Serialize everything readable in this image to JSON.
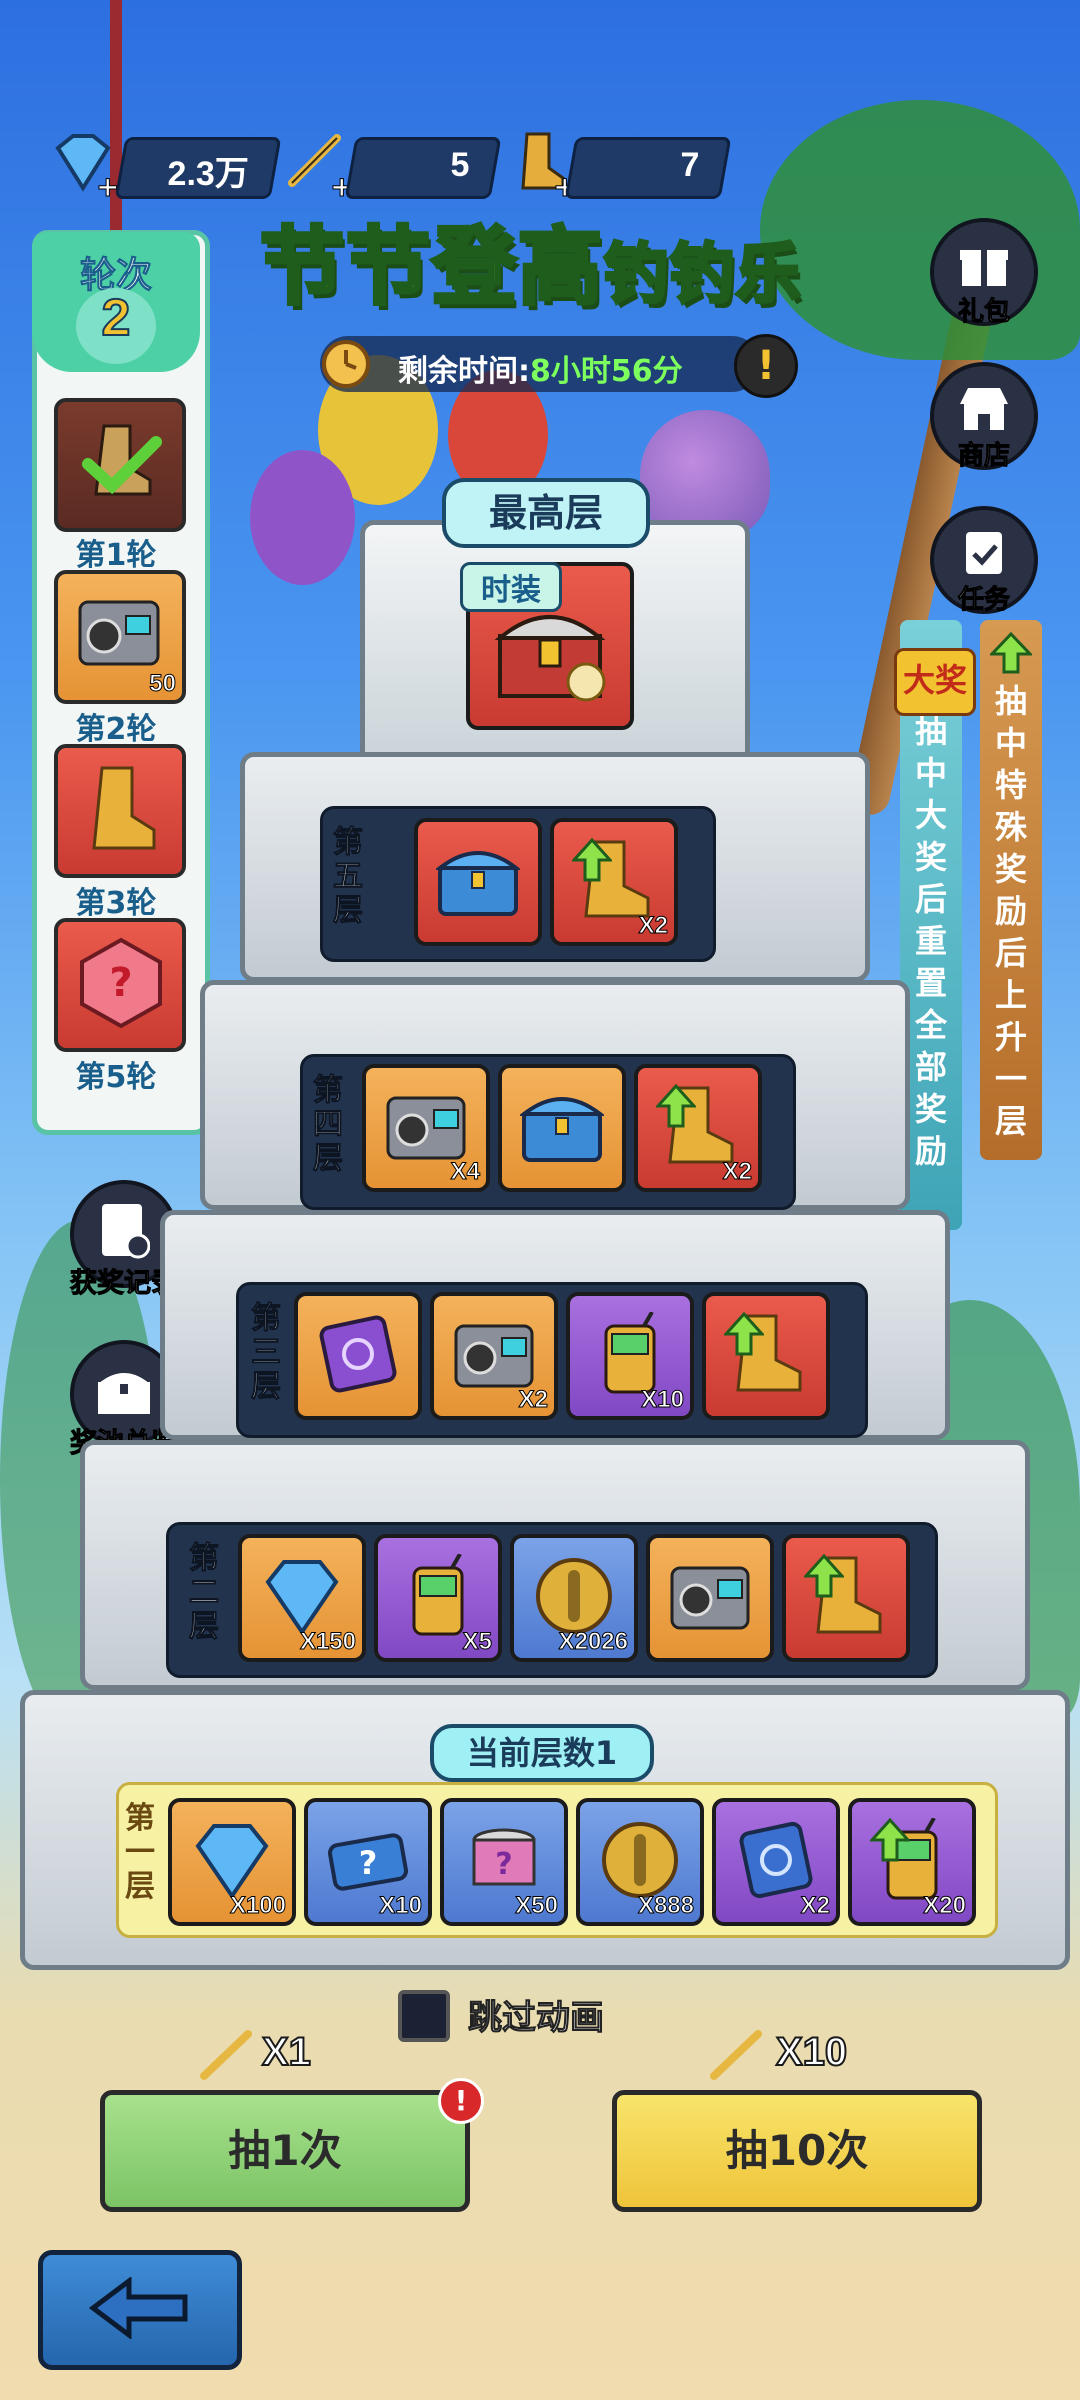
{
  "currency": {
    "diamonds": "2.3万",
    "rods": "5",
    "boots": "7"
  },
  "title": {
    "main": "节节登高",
    "sub": "钓钓乐"
  },
  "timer": {
    "label": "剩余时间:",
    "value": "8小时56分"
  },
  "side_buttons": [
    {
      "label": "礼包",
      "icon": "gift-icon"
    },
    {
      "label": "商店",
      "icon": "shop-icon"
    },
    {
      "label": "任务",
      "icon": "task-icon"
    }
  ],
  "banners": {
    "grand_tag": "大奖",
    "grand_text": "抽中大奖后重置全部奖励",
    "special_text": "抽中特殊奖励后上升一层"
  },
  "rounds": {
    "head_label": "轮次",
    "current": "2",
    "items": [
      {
        "label": "第1轮",
        "icon": "boot-checked-icon",
        "count": ""
      },
      {
        "label": "第2轮",
        "icon": "device-icon",
        "count": "50"
      },
      {
        "label": "第3轮",
        "icon": "boot-icon",
        "count": ""
      },
      {
        "label": "第5轮",
        "icon": "mystery-gem-icon",
        "count": ""
      }
    ]
  },
  "left_buttons": [
    {
      "label": "获奖记录",
      "icon": "record-icon"
    },
    {
      "label": "奖池总览",
      "icon": "chest-icon"
    }
  ],
  "top_floor": {
    "tag": "最高层",
    "item_tag": "时装"
  },
  "floors": [
    {
      "label": "第五层",
      "items": [
        {
          "icon": "blue-chest-icon",
          "count": "",
          "bg": "red"
        },
        {
          "icon": "boot-icon",
          "count": "X2",
          "bg": "red",
          "up": true
        }
      ]
    },
    {
      "label": "第四层",
      "items": [
        {
          "icon": "device-icon",
          "count": "X4",
          "bg": "orange"
        },
        {
          "icon": "blue-chest-icon",
          "count": "",
          "bg": "orange"
        },
        {
          "icon": "boot-icon",
          "count": "X2",
          "bg": "red",
          "up": true
        }
      ]
    },
    {
      "label": "第三层",
      "items": [
        {
          "icon": "purple-card-icon",
          "count": "",
          "bg": "orange"
        },
        {
          "icon": "device-icon",
          "count": "X2",
          "bg": "orange"
        },
        {
          "icon": "radio-icon",
          "count": "X10",
          "bg": "purple"
        },
        {
          "icon": "boot-icon",
          "count": "",
          "bg": "red",
          "up": true
        }
      ]
    },
    {
      "label": "第二层",
      "items": [
        {
          "icon": "diamond-icon",
          "count": "X150",
          "bg": "orange"
        },
        {
          "icon": "radio-icon",
          "count": "X5",
          "bg": "purple"
        },
        {
          "icon": "bullet-coin-icon",
          "count": "X2026",
          "bg": "blue"
        },
        {
          "icon": "device-icon",
          "count": "",
          "bg": "orange"
        },
        {
          "icon": "boot-icon",
          "count": "",
          "bg": "red",
          "up": true
        }
      ]
    },
    {
      "label": "第一层",
      "items": [
        {
          "icon": "diamond-icon",
          "count": "X100",
          "bg": "orange"
        },
        {
          "icon": "mystery-ticket-icon",
          "count": "X10",
          "bg": "blue"
        },
        {
          "icon": "mystery-can-icon",
          "count": "X50",
          "bg": "blue"
        },
        {
          "icon": "bullet-coin-icon",
          "count": "X888",
          "bg": "blue"
        },
        {
          "icon": "blue-card-icon",
          "count": "X2",
          "bg": "purple"
        },
        {
          "icon": "radio-icon",
          "count": "X20",
          "bg": "purple",
          "up": true
        }
      ]
    }
  ],
  "current_floor_tag": "当前层数1",
  "skip_label": "跳过动画",
  "draw": {
    "one": {
      "cost": "X1",
      "label": "抽1次"
    },
    "ten": {
      "cost": "X10",
      "label": "抽10次"
    }
  },
  "colors": {
    "accent_green": "#b7ee57",
    "draw_one": "#8fd27a",
    "draw_ten": "#f5d84a"
  }
}
